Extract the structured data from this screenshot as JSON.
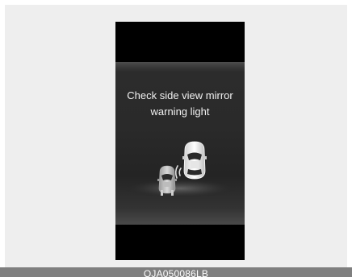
{
  "screen": {
    "message_line1": "Check side view mirror",
    "message_line2": "warning light",
    "icon": "blind-spot-warning-cars-icon"
  },
  "caption": {
    "code": "OJA050086LB"
  },
  "colors": {
    "panel_background": "#eeeeee",
    "screen_background": "#000000",
    "text": "#f2f2f2",
    "caption_bar": "#7f7f7f"
  }
}
